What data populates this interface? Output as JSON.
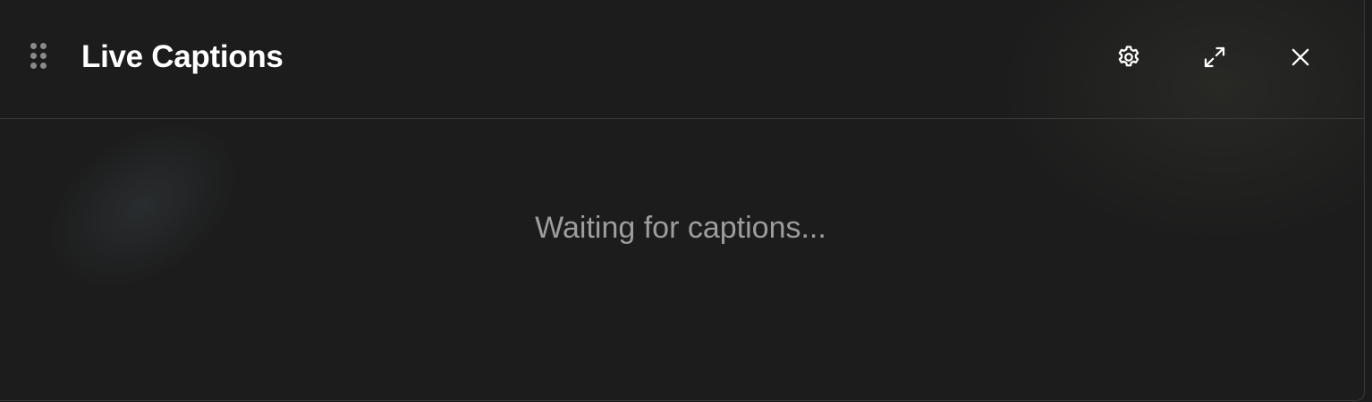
{
  "window": {
    "title": "Live Captions",
    "drag_handle_icon": "drag-handle-icon"
  },
  "toolbar": {
    "settings_icon": "gear-icon",
    "expand_icon": "expand-icon",
    "close_icon": "close-icon"
  },
  "captions": {
    "status_text": "Waiting for captions..."
  },
  "colors": {
    "background": "#1c1c1c",
    "title_text": "#ffffff",
    "status_text": "#9d9d9d",
    "divider": "#3b3b3b",
    "icon": "#ffffff"
  }
}
